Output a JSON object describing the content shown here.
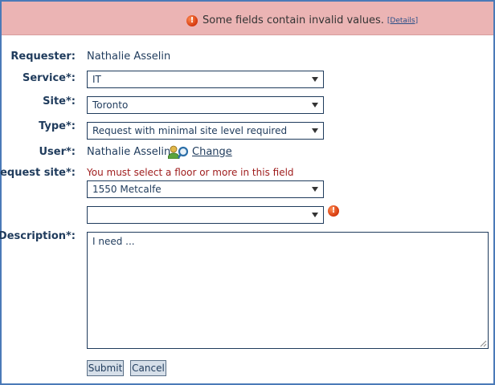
{
  "banner": {
    "message": "Some fields contain invalid values.",
    "details_link": "[Details]",
    "icon": "error-icon",
    "color": "#ebb4b4"
  },
  "form": {
    "requester": {
      "label": "Requester:",
      "value": "Nathalie Asselin"
    },
    "service": {
      "label": "Service*:",
      "value": "IT"
    },
    "site": {
      "label": "Site*:",
      "value": "Toronto"
    },
    "type": {
      "label": "Type*:",
      "value": "Request with minimal site level required"
    },
    "user": {
      "label": "User*:",
      "value": "Nathalie Asselin",
      "change_link": "Change",
      "icon": "user-search-icon"
    },
    "request_site": {
      "label": "Request site*:",
      "error": "You must select a floor or more in this field",
      "building": "1550 Metcalfe",
      "floor": ""
    },
    "description": {
      "label": "Description*:",
      "value": "I need ..."
    }
  },
  "buttons": {
    "submit": "Submit",
    "cancel": "Cancel"
  }
}
